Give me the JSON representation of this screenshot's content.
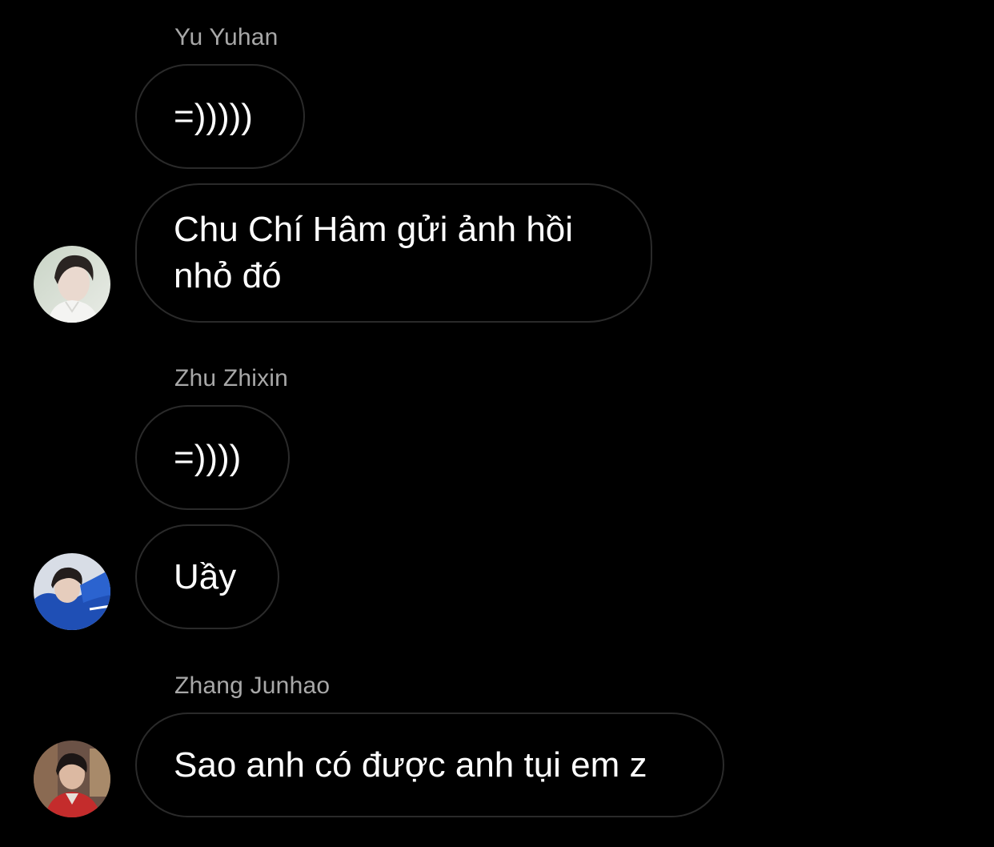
{
  "colors": {
    "background": "#000000",
    "bubble_border": "#2a2a2a",
    "sender_name": "#a8a8a8",
    "message_text": "#ffffff"
  },
  "messages": [
    {
      "sender": "Yu Yuhan",
      "text": "=)))))"
    },
    {
      "text": "Chu Chí Hâm gửi ảnh hồi nhỏ đó",
      "avatar": "user-avatar-yu-yuhan"
    },
    {
      "sender": "Zhu Zhixin",
      "text": "=))))"
    },
    {
      "text": "Uầy",
      "avatar": "user-avatar-zhu-zhixin"
    },
    {
      "sender": "Zhang Junhao",
      "text": "Sao anh có được anh tụi em z",
      "avatar": "user-avatar-zhang-junhao"
    }
  ]
}
